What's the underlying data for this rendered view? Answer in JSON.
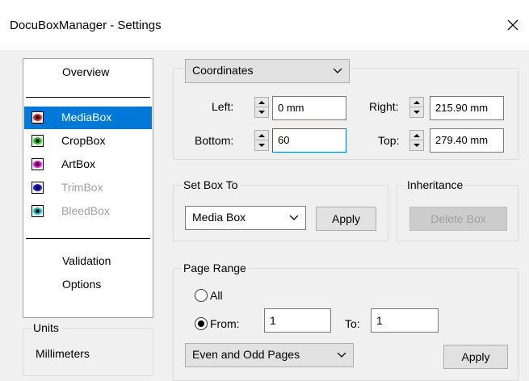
{
  "window": {
    "title": "DocuBoxManager - Settings"
  },
  "sidebar": {
    "overview": "Overview",
    "boxes": [
      {
        "label": "MediaBox",
        "color": "#ff1a1a",
        "selected": true,
        "disabled": false
      },
      {
        "label": "CropBox",
        "color": "#00e000",
        "selected": false,
        "disabled": false
      },
      {
        "label": "ArtBox",
        "color": "#ff00ff",
        "selected": false,
        "disabled": false
      },
      {
        "label": "TrimBox",
        "color": "#1a1aff",
        "selected": false,
        "disabled": true
      },
      {
        "label": "BleedBox",
        "color": "#00c8c8",
        "selected": false,
        "disabled": true
      }
    ],
    "validation": "Validation",
    "options": "Options"
  },
  "units": {
    "legend": "Units",
    "value": "Millimeters"
  },
  "coords": {
    "mode": "Coordinates",
    "left_label": "Left:",
    "left_value": "0 mm",
    "right_label": "Right:",
    "right_value": "215.90 mm",
    "bottom_label": "Bottom:",
    "bottom_value": "60",
    "top_label": "Top:",
    "top_value": "279.40 mm"
  },
  "set_box": {
    "legend": "Set Box To",
    "selected": "Media Box",
    "apply": "Apply"
  },
  "inheritance": {
    "legend": "Inheritance",
    "delete": "Delete Box"
  },
  "page_range": {
    "legend": "Page Range",
    "all_label": "All",
    "from_label": "From:",
    "from_value": "1",
    "to_label": "To:",
    "to_value": "1",
    "subset": "Even and Odd Pages",
    "apply": "Apply"
  }
}
